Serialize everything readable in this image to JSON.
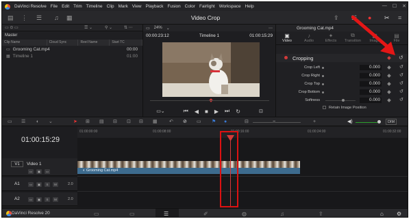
{
  "menu": {
    "app": "DaVinci Resolve",
    "items": [
      "File",
      "Edit",
      "Trim",
      "Timeline",
      "Clip",
      "Mark",
      "View",
      "Playback",
      "Fusion",
      "Color",
      "Fairlight",
      "Workspace",
      "Help"
    ]
  },
  "toolbar": {
    "project_title": "Video Crop"
  },
  "mediapool": {
    "zoom": "24%",
    "folder": "Master",
    "columns": [
      "Clip Name",
      "Cloud Sync",
      "Reel Name",
      "Start TC"
    ],
    "clips": [
      {
        "name": "Grooming Cat.mp4",
        "tc": "00:00"
      },
      {
        "name": "Timeline 1",
        "tc": "01:00"
      }
    ]
  },
  "viewer": {
    "zoom": "24%",
    "source_tc": "00:00:23:12",
    "timeline_name": "Timeline 1",
    "record_tc": "01:00:15:29"
  },
  "inspector": {
    "clip_name": "Grooming Cat.mp4",
    "tabs": [
      "Video",
      "Audio",
      "Effects",
      "Transition",
      "Image",
      "File"
    ],
    "section": "Cropping",
    "params": [
      {
        "label": "Crop Left",
        "value": "0.000"
      },
      {
        "label": "Crop Right",
        "value": "0.000"
      },
      {
        "label": "Crop Top",
        "value": "0.000"
      },
      {
        "label": "Crop Bottom",
        "value": "0.000"
      },
      {
        "label": "Softness",
        "value": "0.000"
      }
    ],
    "retain_label": "Retain Image Position"
  },
  "timeline": {
    "timecode": "01:00:15:29",
    "ruler": [
      "01:00:00:00",
      "01:00:08:00",
      "01:00:16:00",
      "01:00:24:00",
      "01:00:32:00"
    ],
    "tracks": [
      {
        "id": "V1",
        "name": "Video 1"
      },
      {
        "id": "A1",
        "level": "2.0"
      },
      {
        "id": "A2",
        "level": "2.0"
      }
    ],
    "clip_label": "Grooming Cat.mp4",
    "dim_label": "DIM"
  },
  "bottom": {
    "app_name": "DaVinci Resolve 20"
  },
  "colors": {
    "accent_red": "#d23a3a",
    "audio_clip": "#3d6b8e",
    "annotation": "#dd1111"
  },
  "icons": [
    "app-logo-icon",
    "search-icon",
    "list-view-icon",
    "play-icon",
    "stop-icon",
    "loop-icon",
    "keyframe-icon",
    "reset-icon",
    "blade-icon",
    "link-icon",
    "flag-icon",
    "volume-icon",
    "home-icon",
    "settings-icon"
  ]
}
